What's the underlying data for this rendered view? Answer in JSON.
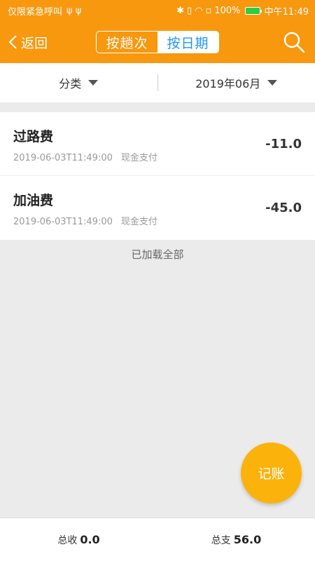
{
  "status_bar": {
    "left_text": "仅限紧急呼叫",
    "usb_icons": "ψ ψ",
    "battery": "100%",
    "time": "中午11:49"
  },
  "nav": {
    "back_label": "返回",
    "seg_left": "按趟次",
    "seg_right": "按日期",
    "active": "按日期"
  },
  "filters": {
    "category": "分类",
    "month": "2019年06月"
  },
  "records": [
    {
      "title": "过路费",
      "datetime": "2019-06-03T11:49:00",
      "method": "现金支付",
      "amount": "-11.0"
    },
    {
      "title": "加油费",
      "datetime": "2019-06-03T11:49:00",
      "method": "现金支付",
      "amount": "-45.0"
    }
  ],
  "loaded_text": "已加载全部",
  "fab_label": "记账",
  "footer": {
    "income_label": "总收",
    "income_value": "0.0",
    "expense_label": "总支",
    "expense_value": "56.0"
  },
  "colors": {
    "header": "#f7980f",
    "fab": "#fbb20b",
    "segment_active_text": "#2196f3"
  }
}
